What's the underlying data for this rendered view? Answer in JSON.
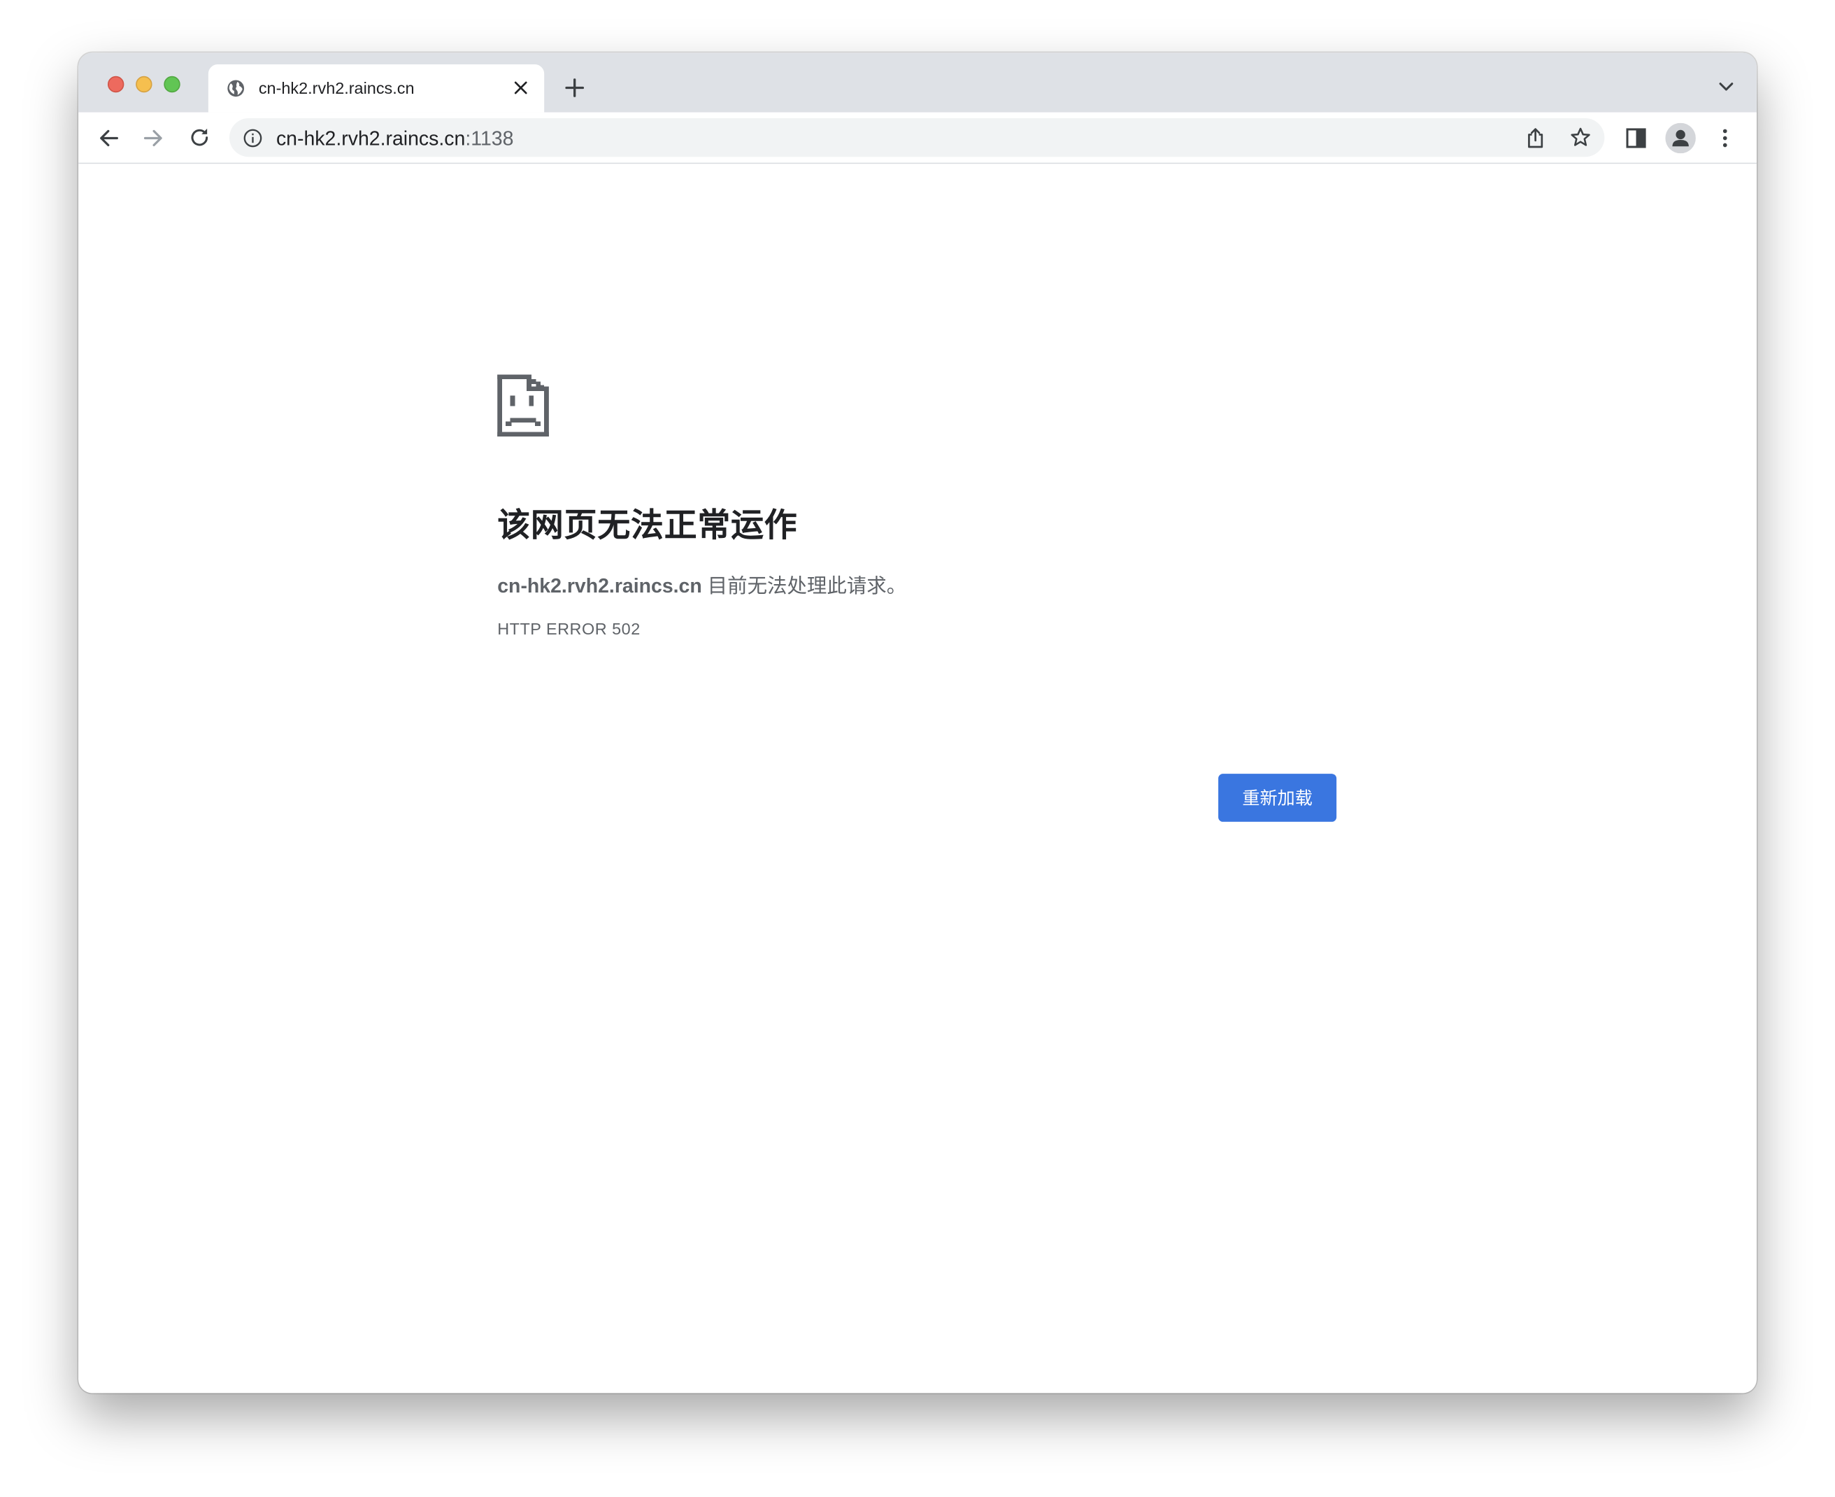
{
  "browser": {
    "tab": {
      "title": "cn-hk2.rvh2.raincs.cn",
      "favicon": "globe-icon"
    },
    "omnibox": {
      "host": "cn-hk2.rvh2.raincs.cn",
      "port": ":1138"
    },
    "icons": {
      "back": "arrow-left-icon",
      "forward": "arrow-right-icon",
      "reload": "reload-icon",
      "site_info": "info-icon",
      "share": "share-icon",
      "bookmark": "star-icon",
      "side_panel": "side-panel-icon",
      "profile": "profile-icon",
      "menu": "kebab-menu-icon",
      "new_tab": "plus-icon",
      "tab_search": "chevron-down-icon",
      "tab_close": "close-icon"
    }
  },
  "error_page": {
    "icon": "sad-page-icon",
    "heading": "该网页无法正常运作",
    "description_host": "cn-hk2.rvh2.raincs.cn",
    "description_text": " 目前无法处理此请求。",
    "error_code": "HTTP ERROR 502",
    "reload_label": "重新加载"
  },
  "colors": {
    "accent": "#3a76e0",
    "titlebar": "#dee1e6",
    "omnibox": "#f1f3f4",
    "text_primary": "#202124",
    "text_secondary": "#5f6368"
  }
}
